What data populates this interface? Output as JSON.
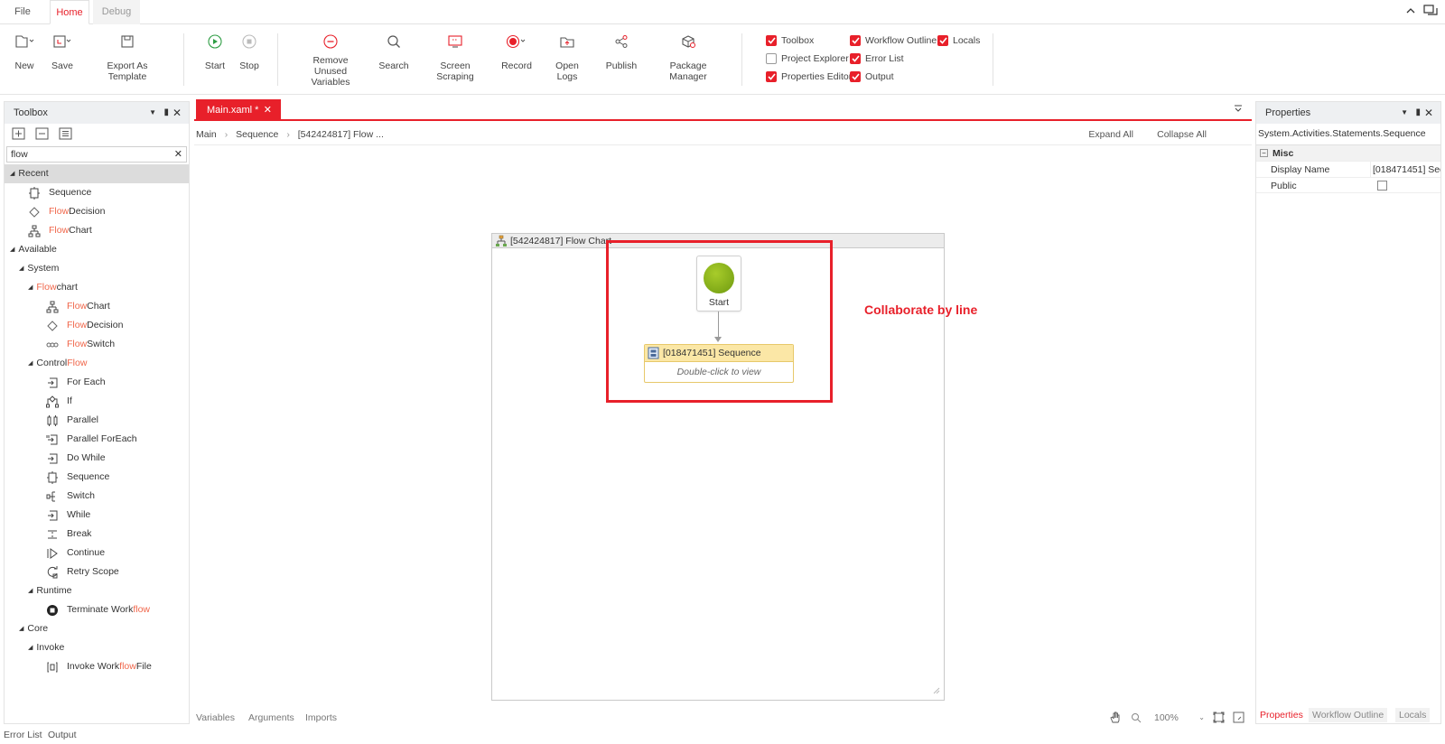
{
  "menubar": {
    "tabs": [
      {
        "label": "File"
      },
      {
        "label": "Home"
      },
      {
        "label": "Debug"
      }
    ]
  },
  "ribbon": {
    "buttons": {
      "new": "New",
      "save": "Save",
      "export_template": "Export As Template",
      "start": "Start",
      "stop": "Stop",
      "remove_unused_1": "Remove Unused",
      "remove_unused_2": "Variables",
      "search": "Search",
      "screen_scraping": "Screen Scraping",
      "record": "Record",
      "open_logs": "Open Logs",
      "publish": "Publish",
      "package_manager": "Package Manager"
    },
    "checks": {
      "toolbox": {
        "label": "Toolbox",
        "checked": true
      },
      "project_explorer": {
        "label": "Project Explorer",
        "checked": false
      },
      "properties_editor": {
        "label": "Properties Editor",
        "checked": true
      },
      "workflow_outline": {
        "label": "Workflow Outline",
        "checked": true
      },
      "error_list": {
        "label": "Error List",
        "checked": true
      },
      "output": {
        "label": "Output",
        "checked": true
      },
      "locals": {
        "label": "Locals",
        "checked": true
      }
    }
  },
  "toolbox": {
    "title": "Toolbox",
    "search_value": "flow",
    "groups": {
      "recent": "Recent",
      "available": "Available",
      "system": "System",
      "flowchart_a": "Flow",
      "flowchart_b": "chart",
      "control_a": "Control ",
      "control_b": "Flow",
      "runtime": "Runtime",
      "core": "Core",
      "invoke": "Invoke"
    },
    "recent_items": [
      {
        "hl": "",
        "rest": "Sequence"
      },
      {
        "hl": "Flow",
        "rest": " Decision"
      },
      {
        "hl": "Flow",
        "rest": " Chart"
      }
    ],
    "flowchart_items": [
      {
        "hl": "Flow",
        "rest": " Chart"
      },
      {
        "hl": "Flow",
        "rest": " Decision"
      },
      {
        "hl": "Flow",
        "rest": " Switch"
      }
    ],
    "control_items": [
      "For Each",
      "If",
      "Parallel",
      "Parallel ForEach",
      "Do While",
      "Sequence",
      "Switch",
      "While",
      "Break",
      "Continue",
      "Retry Scope"
    ],
    "runtime_item": {
      "pre": "Terminate Work",
      "hl": "flow"
    },
    "invoke_item": {
      "pre": "Invoke Work",
      "hl": "flow",
      "post": " File"
    }
  },
  "designer": {
    "tab_label": "Main.xaml *",
    "breadcrumb": [
      "Main",
      "Sequence",
      "[542424817] Flow ..."
    ],
    "expand_all": "Expand All",
    "collapse_all": "Collapse All",
    "flowchart_title": "[542424817] Flow Chart",
    "start_label": "Start",
    "sequence_title": "[018471451] Sequence",
    "sequence_hint": "Double-click to view",
    "annotation": "Collaborate by line",
    "bottom_tabs": [
      "Variables",
      "Arguments",
      "Imports"
    ],
    "zoom": "100%"
  },
  "properties": {
    "title": "Properties",
    "type": "System.Activities.Statements.Sequence",
    "category": "Misc",
    "rows": [
      {
        "name": "Display Name",
        "value": "[018471451] Seq"
      },
      {
        "name": "Public",
        "value": ""
      }
    ],
    "bottom_tabs": [
      "Properties",
      "Workflow Outline",
      "Locals"
    ]
  },
  "status": {
    "error_list": "Error List",
    "output": "Output"
  },
  "colors": {
    "accent": "#e8202a",
    "highlight": "#f0664a",
    "start_node": "#7aa614",
    "sequence_header": "#fbe7a6"
  }
}
